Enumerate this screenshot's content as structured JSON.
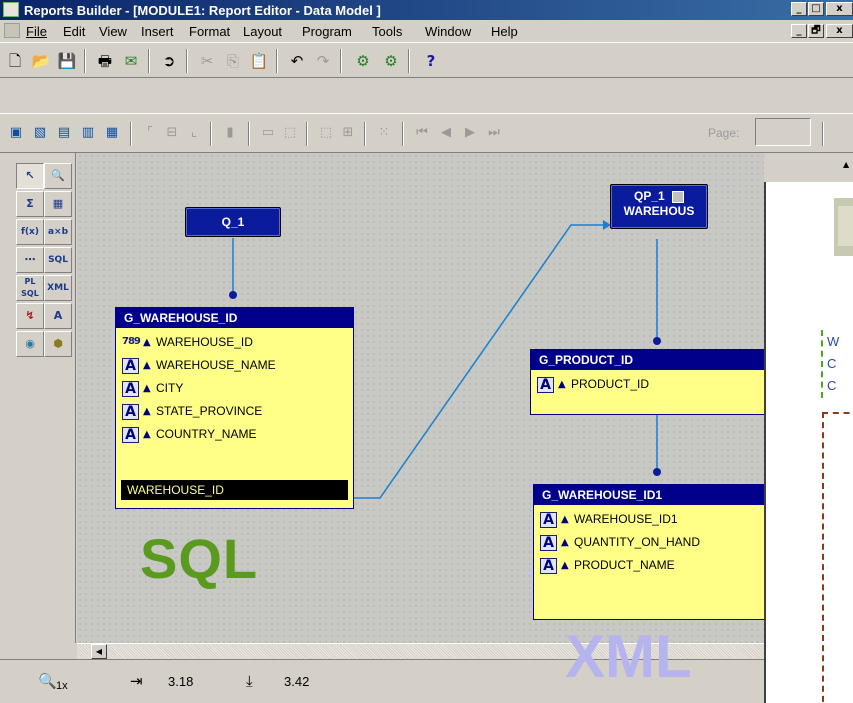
{
  "window": {
    "title": "Reports Builder - [MODULE1: Report Editor - Data Model ]",
    "controls": {
      "minimize": "_",
      "restore": "□",
      "close": "x",
      "mdi_min": "_",
      "mdi_restore": "🗗",
      "mdi_close": "x"
    }
  },
  "menu": {
    "items": [
      {
        "label": "File",
        "icon": "app-icon"
      },
      {
        "label": "Edit"
      },
      {
        "label": "View"
      },
      {
        "label": "Insert"
      },
      {
        "label": "Format"
      },
      {
        "label": "Layout"
      },
      {
        "label": "Program"
      },
      {
        "label": "Tools"
      },
      {
        "label": "Window"
      },
      {
        "label": "Help"
      }
    ]
  },
  "toolbar": {
    "buttons": [
      "new-icon",
      "open-icon",
      "save-icon",
      "print-icon",
      "mail-icon",
      "run-icon",
      "cut-icon",
      "copy-icon",
      "paste-icon",
      "undo-icon",
      "redo-icon",
      "compile-icon",
      "debug-icon",
      "help-icon"
    ],
    "help_symbol": "?"
  },
  "layout_toolbar": {
    "page_label": "Page:",
    "page_value": ""
  },
  "palette": {
    "tools": [
      {
        "name": "select-tool",
        "glyph": "↖"
      },
      {
        "name": "magnify-tool",
        "glyph": "🔍"
      },
      {
        "name": "summary-column-tool",
        "glyph": "Σ"
      },
      {
        "name": "formula-column-tool",
        "glyph": "▦"
      },
      {
        "name": "function-tool",
        "glyph": "f(x)"
      },
      {
        "name": "placeholder-tool",
        "glyph": "a×b"
      },
      {
        "name": "cross-product-tool",
        "glyph": "⋯"
      },
      {
        "name": "sql-query-tool",
        "glyph": "SQL"
      },
      {
        "name": "plsql-query-tool",
        "glyph": "PL SQL"
      },
      {
        "name": "xml-query-tool",
        "glyph": "XML"
      },
      {
        "name": "ref-cursor-tool",
        "glyph": "↯"
      },
      {
        "name": "text-query-tool",
        "glyph": "A"
      },
      {
        "name": "ole-query-tool",
        "glyph": "◉"
      },
      {
        "name": "jdbc-query-tool",
        "glyph": "⬢"
      }
    ]
  },
  "data_model": {
    "queries": [
      {
        "name": "Q_1"
      },
      {
        "name": "QP_1",
        "subtitle": "WAREHOUS"
      }
    ],
    "groups": [
      {
        "name": "G_WAREHOUSE_ID",
        "columns": [
          {
            "type": "number",
            "label": "WAREHOUSE_ID"
          },
          {
            "type": "char",
            "label": "WAREHOUSE_NAME"
          },
          {
            "type": "char",
            "label": "CITY"
          },
          {
            "type": "char",
            "label": "STATE_PROVINCE"
          },
          {
            "type": "char",
            "label": "COUNTRY_NAME"
          }
        ],
        "link_column": "WAREHOUSE_ID"
      },
      {
        "name": "G_PRODUCT_ID",
        "columns": [
          {
            "type": "char",
            "label": "PRODUCT_ID"
          }
        ]
      },
      {
        "name": "G_WAREHOUSE_ID1",
        "columns": [
          {
            "type": "char",
            "label": "WAREHOUSE_ID1"
          },
          {
            "type": "char",
            "label": "QUANTITY_ON_HAND"
          },
          {
            "type": "char",
            "label": "PRODUCT_NAME"
          }
        ]
      }
    ],
    "type_glyphs": {
      "number": "789",
      "char": "A"
    },
    "arrow_glyph": "▲"
  },
  "overlays": {
    "sql_label": "SQL",
    "xml_label": "XML"
  },
  "status": {
    "zoom": "1x",
    "pos_x": "3.18",
    "pos_y": "3.42"
  },
  "right_panel": {
    "lines": [
      "W",
      "C",
      "C"
    ]
  }
}
